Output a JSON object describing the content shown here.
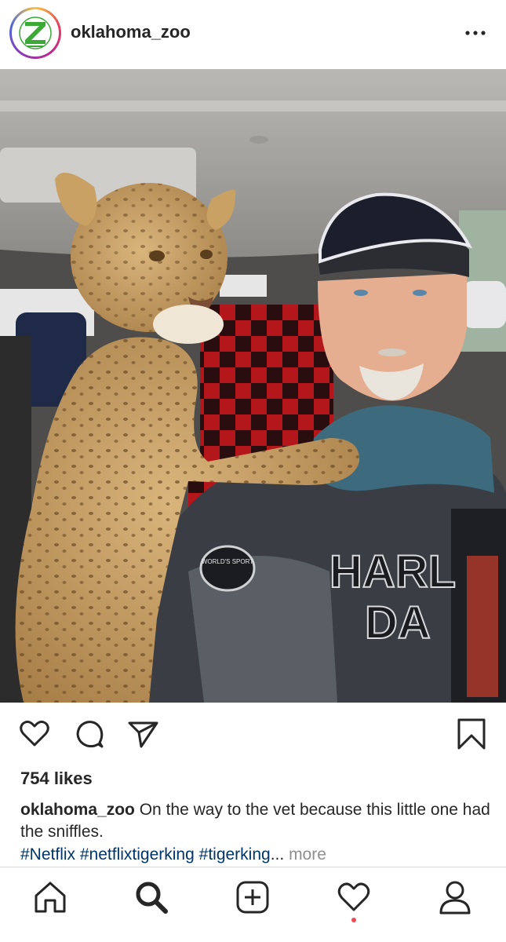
{
  "post": {
    "username": "oklahoma_zoo",
    "likes": "754 likes",
    "caption_user": "oklahoma_zoo",
    "caption_text": "On the way to the vet because this little one had the sniffles.",
    "hashtags": [
      "#Netflix",
      "#netflixtigerking",
      "#tigerking"
    ],
    "ellipsis": "...",
    "more_label": "more"
  },
  "photo": {
    "jacket_text_1": "HARL",
    "jacket_text_2": "DA",
    "patch_text": "WORLD'S SPORT"
  },
  "icons": {
    "header": [
      "zoo-logo-icon",
      "more-options-icon"
    ],
    "actions": [
      "heart-icon",
      "comment-icon",
      "share-icon",
      "bookmark-icon"
    ],
    "tabs": [
      "home-icon",
      "search-icon",
      "add-post-icon",
      "activity-heart-icon",
      "profile-icon"
    ]
  },
  "colors": {
    "text": "#262626",
    "hashtag": "#003569",
    "muted": "#8e8e8e",
    "notification": "#ed4956",
    "logo_green": "#3aa935"
  }
}
